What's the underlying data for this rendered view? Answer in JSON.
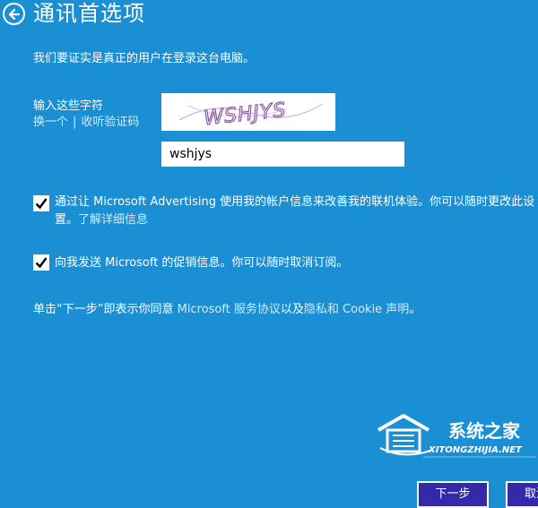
{
  "header": {
    "title": "通讯首选项"
  },
  "subtitle": "我们要证实是真正的用户在登录这台电脑。",
  "captcha": {
    "label": "输入这些字符",
    "refresh_link": "换一个",
    "separator": "|",
    "audio_link": "收听验证码",
    "image_text": "WSHJYS",
    "input_value": "wshjys"
  },
  "options": [
    {
      "checked": true,
      "text": "通过让 Microsoft Advertising 使用我的帐户信息来改善我的联机体验。你可以随时更改此设置。",
      "link": "了解详细信息"
    },
    {
      "checked": true,
      "text": "向我发送 Microsoft 的促销信息。你可以随时取消订阅。"
    }
  ],
  "agreement": {
    "prefix": "单击“下一步”即表示你同意 ",
    "service_link": "Microsoft 服务协议",
    "middle": "以及",
    "privacy_link": "隐私和 Cookie 声明",
    "suffix": "。"
  },
  "watermark": {
    "name": "系统之家",
    "url": "XITONGZHIJIA.NET"
  },
  "buttons": {
    "next": "下一步",
    "cancel": "取消"
  },
  "colors": {
    "background": "#1a8fd3",
    "button": "#342aa8"
  }
}
